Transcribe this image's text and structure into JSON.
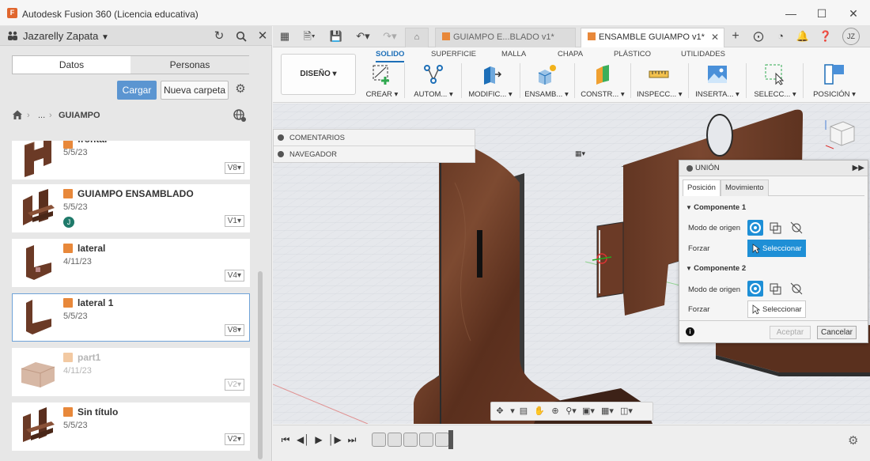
{
  "window": {
    "title": "Autodesk Fusion 360 (Licencia educativa)",
    "minimize": "—",
    "maximize": "☐",
    "close": "✕"
  },
  "data_panel": {
    "user": "Jazarelly Zapata",
    "tabs": [
      "Datos",
      "Personas"
    ],
    "upload_label": "Cargar",
    "new_folder_label": "Nueva carpeta",
    "breadcrumb": {
      "ellipsis": "...",
      "folder": "GUIAMPO"
    },
    "files": [
      {
        "name": "frontal",
        "date": "5/5/23",
        "version": "V8"
      },
      {
        "name": "GUIAMPO ENSAMBLADO",
        "date": "5/5/23",
        "version": "V1",
        "badge": "J"
      },
      {
        "name": "lateral",
        "date": "4/11/23",
        "version": "V4"
      },
      {
        "name": "lateral 1",
        "date": "5/5/23",
        "version": "V8"
      },
      {
        "name": "part1",
        "date": "4/11/23",
        "version": "V2"
      },
      {
        "name": "Sin título",
        "date": "5/5/23",
        "version": "V2"
      }
    ]
  },
  "doc_tabs": [
    {
      "label": "GUIAMPO E...BLADO v1*"
    },
    {
      "label": "ENSAMBLE GUIAMPO v1*"
    }
  ],
  "profile_initials": "JZ",
  "ribbon": {
    "workspace": "DISEÑO",
    "tabs": [
      "SOLIDO",
      "SUPERFICIE",
      "MALLA",
      "CHAPA",
      "PLÁSTICO",
      "UTILIDADES"
    ],
    "groups": [
      "CREAR",
      "AUTOM...",
      "MODIFIC...",
      "ENSAMB...",
      "CONSTR...",
      "INSPECC...",
      "INSERTA...",
      "SELECC...",
      "POSICIÓN"
    ]
  },
  "browser_panels": [
    "COMENTARIOS",
    "NAVEGADOR"
  ],
  "union_dialog": {
    "title": "UNIÓN",
    "tabs": [
      "Posición",
      "Movimiento"
    ],
    "component1": "Componente 1",
    "component2": "Componente 2",
    "origin_mode_label": "Modo de origen",
    "force_label": "Forzar",
    "select_label": "Seleccionar",
    "ok_label": "Aceptar",
    "cancel_label": "Cancelar"
  },
  "colors": {
    "accent": "#1e8fd6",
    "wood": "#6b3a26",
    "upload_button": "#5b95d1"
  }
}
